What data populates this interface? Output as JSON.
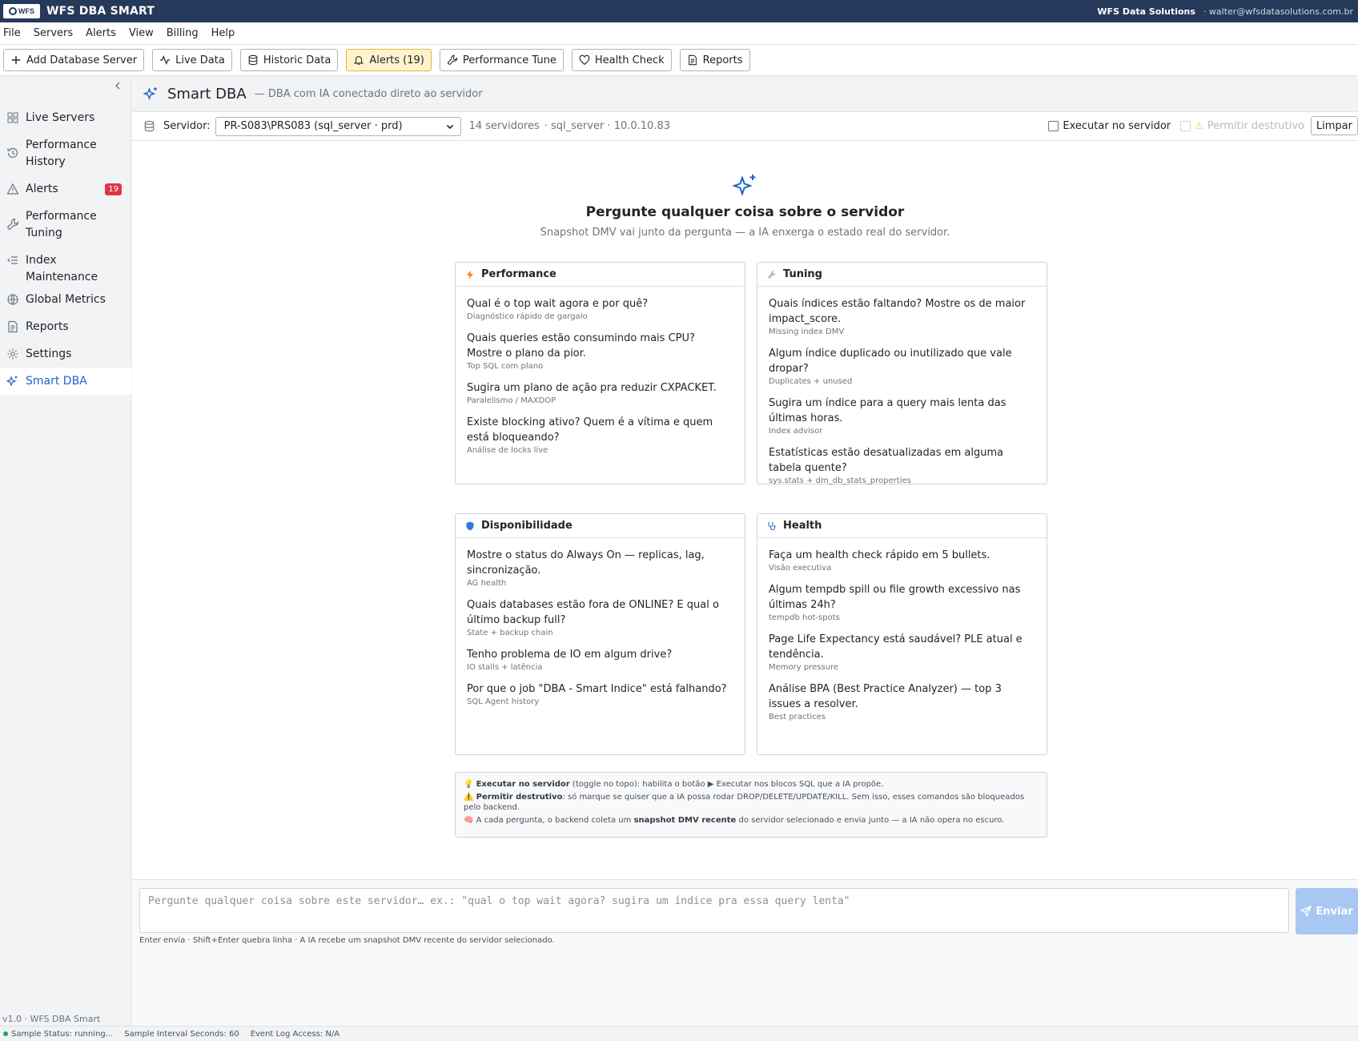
{
  "app": {
    "logo_text": "WFS",
    "title": "WFS DBA SMART",
    "company": "WFS Data Solutions",
    "user_email": "· walter@wfsdatasolutions.com.br"
  },
  "menu": [
    "File",
    "Servers",
    "Alerts",
    "View",
    "Billing",
    "Help"
  ],
  "toolbar": {
    "add_server": "Add Database Server",
    "live_data": "Live Data",
    "historic_data": "Historic Data",
    "alerts": "Alerts (19)",
    "performance_tune": "Performance Tune",
    "health_check": "Health Check",
    "reports": "Reports"
  },
  "sidebar": {
    "items": [
      {
        "label": "Live Servers"
      },
      {
        "label": "Performance History"
      },
      {
        "label": "Alerts",
        "badge": "19"
      },
      {
        "label": "Performance Tuning"
      },
      {
        "label": "Index Maintenance"
      },
      {
        "label": "Global Metrics"
      },
      {
        "label": "Reports"
      },
      {
        "label": "Settings"
      },
      {
        "label": "Smart DBA"
      }
    ],
    "version": "v1.0 · WFS DBA Smart"
  },
  "header": {
    "title": "Smart DBA",
    "subtitle": "— DBA com IA conectado direto ao servidor"
  },
  "server_bar": {
    "label": "Servidor:",
    "selected": "PR-S083\\PRS083 (sql_server · prd)",
    "count": "14 servidores",
    "details": "· sql_server · 10.0.10.83",
    "execute_label": "Executar no servidor",
    "destructive_label": "Permitir destrutivo",
    "clear_label": "Limpar"
  },
  "hero": {
    "title": "Pergunte qualquer coisa sobre o servidor",
    "subtitle": "Snapshot DMV vai junto da pergunta — a IA enxerga o estado real do servidor."
  },
  "cards": {
    "performance": {
      "title": "Performance",
      "questions": [
        {
          "q": "Qual é o top wait agora e por quê?",
          "s": "Diagnóstico rápido de gargalo"
        },
        {
          "q": "Quais queries estão consumindo mais CPU? Mostre o plano da pior.",
          "s": "Top SQL com plano"
        },
        {
          "q": "Sugira um plano de ação pra reduzir CXPACKET.",
          "s": "Paralelismo / MAXDOP"
        },
        {
          "q": "Existe blocking ativo? Quem é a vítima e quem está bloqueando?",
          "s": "Análise de locks live"
        }
      ]
    },
    "tuning": {
      "title": "Tuning",
      "questions": [
        {
          "q": "Quais índices estão faltando? Mostre os de maior impact_score.",
          "s": "Missing index DMV"
        },
        {
          "q": "Algum índice duplicado ou inutilizado que vale dropar?",
          "s": "Duplicates + unused"
        },
        {
          "q": "Sugira um índice para a query mais lenta das últimas horas.",
          "s": "Index advisor"
        },
        {
          "q": "Estatísticas estão desatualizadas em alguma tabela quente?",
          "s": "sys.stats + dm_db_stats_properties"
        }
      ]
    },
    "disponibilidade": {
      "title": "Disponibilidade",
      "questions": [
        {
          "q": "Mostre o status do Always On — replicas, lag, sincronização.",
          "s": "AG health"
        },
        {
          "q": "Quais databases estão fora de ONLINE? E qual o último backup full?",
          "s": "State + backup chain"
        },
        {
          "q": "Tenho problema de IO em algum drive?",
          "s": "IO stalls + latência"
        },
        {
          "q": "Por que o job \"DBA - Smart Indice\" está falhando?",
          "s": "SQL Agent history"
        }
      ]
    },
    "health": {
      "title": "Health",
      "questions": [
        {
          "q": "Faça um health check rápido em 5 bullets.",
          "s": "Visão executiva"
        },
        {
          "q": "Algum tempdb spill ou file growth excessivo nas últimas 24h?",
          "s": "tempdb hot-spots"
        },
        {
          "q": "Page Life Expectancy está saudável? PLE atual e tendência.",
          "s": "Memory pressure"
        },
        {
          "q": "Análise BPA (Best Practice Analyzer) — top 3 issues a resolver.",
          "s": "Best practices"
        }
      ]
    }
  },
  "info": {
    "exec_title": "Executar no servidor",
    "exec_text": " (toggle no topo): habilita o botão ▶ Executar nos blocos SQL que a IA propõe.",
    "destr_title": "Permitir destrutivo",
    "destr_text": ": só marque se quiser que a IA possa rodar DROP/DELETE/UPDATE/KILL. Sem isso, esses comandos são bloqueados pelo backend.",
    "snap_pre": " A cada pergunta, o backend coleta um ",
    "snap_bold": "snapshot DMV recente",
    "snap_post": " do servidor selecionado e envia junto — a IA não opera no escuro."
  },
  "composer": {
    "placeholder": "Pergunte qualquer coisa sobre este servidor… ex.: \"qual o top wait agora? sugira um índice pra essa query lenta\"",
    "send_label": "Enviar",
    "hint": "Enter envia · Shift+Enter quebra linha · A IA recebe um snapshot DMV recente do servidor selecionado."
  },
  "status": {
    "sample_status_label": "Sample Status:",
    "sample_status": "running...",
    "interval_label": "Sample Interval Seconds:",
    "interval": "60",
    "event_log_label": "Event Log Access:",
    "event_log": "N/A"
  },
  "colors": {
    "titlebar": "#25395a",
    "accent": "#1f63c9",
    "alert_badge": "#dc3545",
    "alerts_button_bg": "#fff3cd",
    "send_button": "#a9c7f3"
  }
}
